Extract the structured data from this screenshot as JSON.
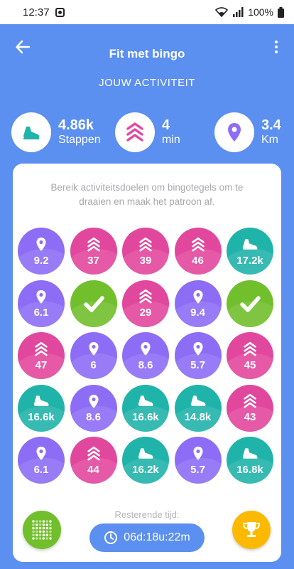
{
  "status_bar": {
    "time": "12:37",
    "battery": "100%"
  },
  "header": {
    "title": "Fit met bingo"
  },
  "section_title": "JOUW ACTIVITEIT",
  "stats": [
    {
      "value": "4.86k",
      "label": "Stappen",
      "icon": "shoe-icon",
      "color": "#20b3aa"
    },
    {
      "value": "4",
      "label": "min",
      "icon": "chevrons-up-icon",
      "color": "#e2479e"
    },
    {
      "value": "3.4",
      "label": "Km",
      "icon": "location-pin-icon",
      "color": "#8d6df5"
    }
  ],
  "card": {
    "instructions": "Bereik activiteitsdoelen om bingotegels om te draaien en maak het patroon af.",
    "remaining_label": "Resterende tijd:"
  },
  "tiles": [
    [
      {
        "type": "distance",
        "value": "9.2"
      },
      {
        "type": "minutes",
        "value": "37"
      },
      {
        "type": "minutes",
        "value": "39"
      },
      {
        "type": "minutes",
        "value": "46"
      },
      {
        "type": "steps",
        "value": "17.2k"
      }
    ],
    [
      {
        "type": "distance",
        "value": "6.1"
      },
      {
        "type": "done",
        "value": ""
      },
      {
        "type": "minutes",
        "value": "29"
      },
      {
        "type": "distance",
        "value": "9.4"
      },
      {
        "type": "done",
        "value": ""
      }
    ],
    [
      {
        "type": "minutes",
        "value": "47"
      },
      {
        "type": "distance",
        "value": "6"
      },
      {
        "type": "distance",
        "value": "8.6"
      },
      {
        "type": "distance",
        "value": "5.7"
      },
      {
        "type": "minutes",
        "value": "45"
      }
    ],
    [
      {
        "type": "steps",
        "value": "16.6k"
      },
      {
        "type": "distance",
        "value": "8.6"
      },
      {
        "type": "steps",
        "value": "16.6k"
      },
      {
        "type": "steps",
        "value": "14.8k"
      },
      {
        "type": "minutes",
        "value": "43"
      }
    ],
    [
      {
        "type": "distance",
        "value": "6.1"
      },
      {
        "type": "minutes",
        "value": "44"
      },
      {
        "type": "steps",
        "value": "16.2k"
      },
      {
        "type": "distance",
        "value": "5.7"
      },
      {
        "type": "steps",
        "value": "16.8k"
      }
    ]
  ],
  "tile_colors": {
    "distance": "#8d6df5",
    "minutes": "#e2479e",
    "steps": "#20b3aa",
    "done": "#71bf2c"
  },
  "timer": {
    "remaining": "06d:18u:22m"
  }
}
